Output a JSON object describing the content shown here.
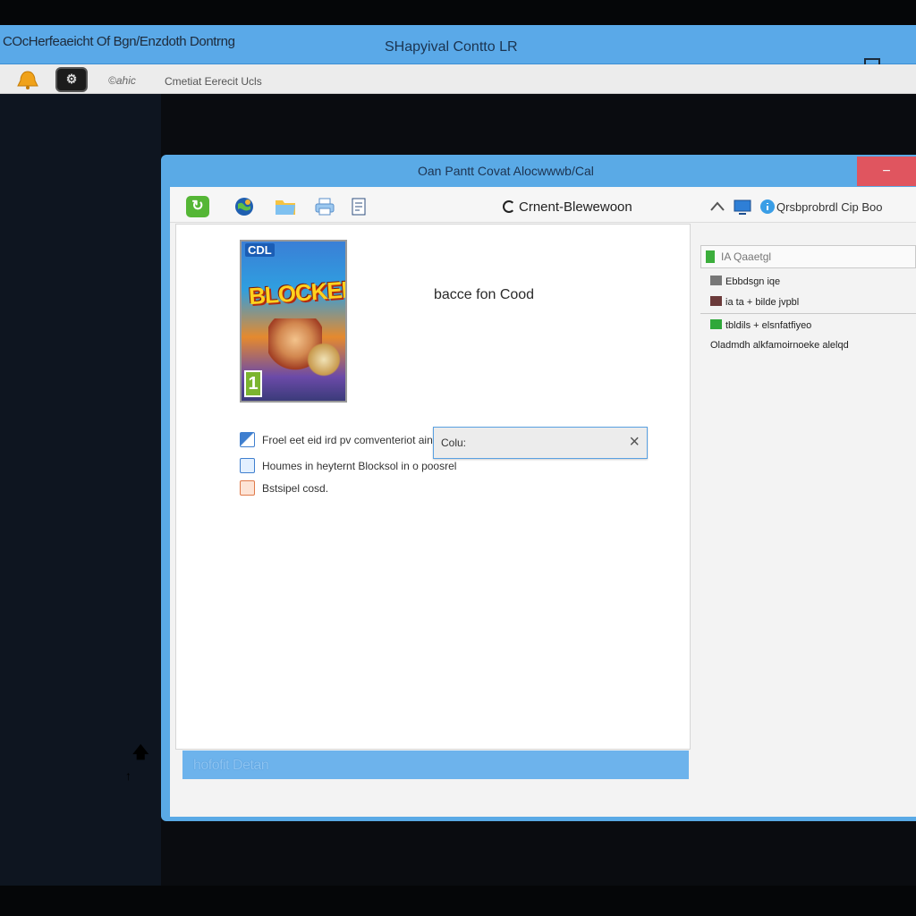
{
  "outer_window": {
    "title_left": "COcHerfeaeicht Of Bgn/Enzdoth Dontrng",
    "title_center": "SHapyival Contto LR",
    "toolbar_label_1": "©ahic",
    "toolbar_label_2": "Cmetiat Eerecit Ucls"
  },
  "dialog": {
    "title": "Oan Pantt Covat Alocwwwb/Cal",
    "close_symbol": "−",
    "toolbar_center": "Crnent-Blewewoon",
    "toolbar_right": "Qrsbprobrdl Cip Boo",
    "cover": {
      "logo": "CDL",
      "title": "BLOCKED",
      "rating": "1"
    },
    "heading": "bacce fon Cood",
    "rows": [
      {
        "text": "Froel eet eid ird pv comventeriot aine",
        "icon": "pen-icon"
      },
      {
        "text": "Houmes in heyternt Blocksol in o poosrel",
        "icon": "document-icon"
      },
      {
        "text": "Bstsipel cosd.",
        "icon": "image-icon"
      }
    ],
    "combo": {
      "label": "Colu:",
      "close_symbol": "×"
    },
    "status_text": "hofofit Detan",
    "side": {
      "search_text": "IA Qaaetgl",
      "items": [
        "Ebbdsgn iqe",
        "ia ta + bilde jvpbl",
        "tbldils + elsnfatfiyeo",
        "Oladmdh alkfamoirnoeke alelqd"
      ]
    }
  },
  "colors": {
    "titlebar_blue": "#5aa9e8",
    "close_red": "#e0555f",
    "accent_green": "#55b636"
  }
}
